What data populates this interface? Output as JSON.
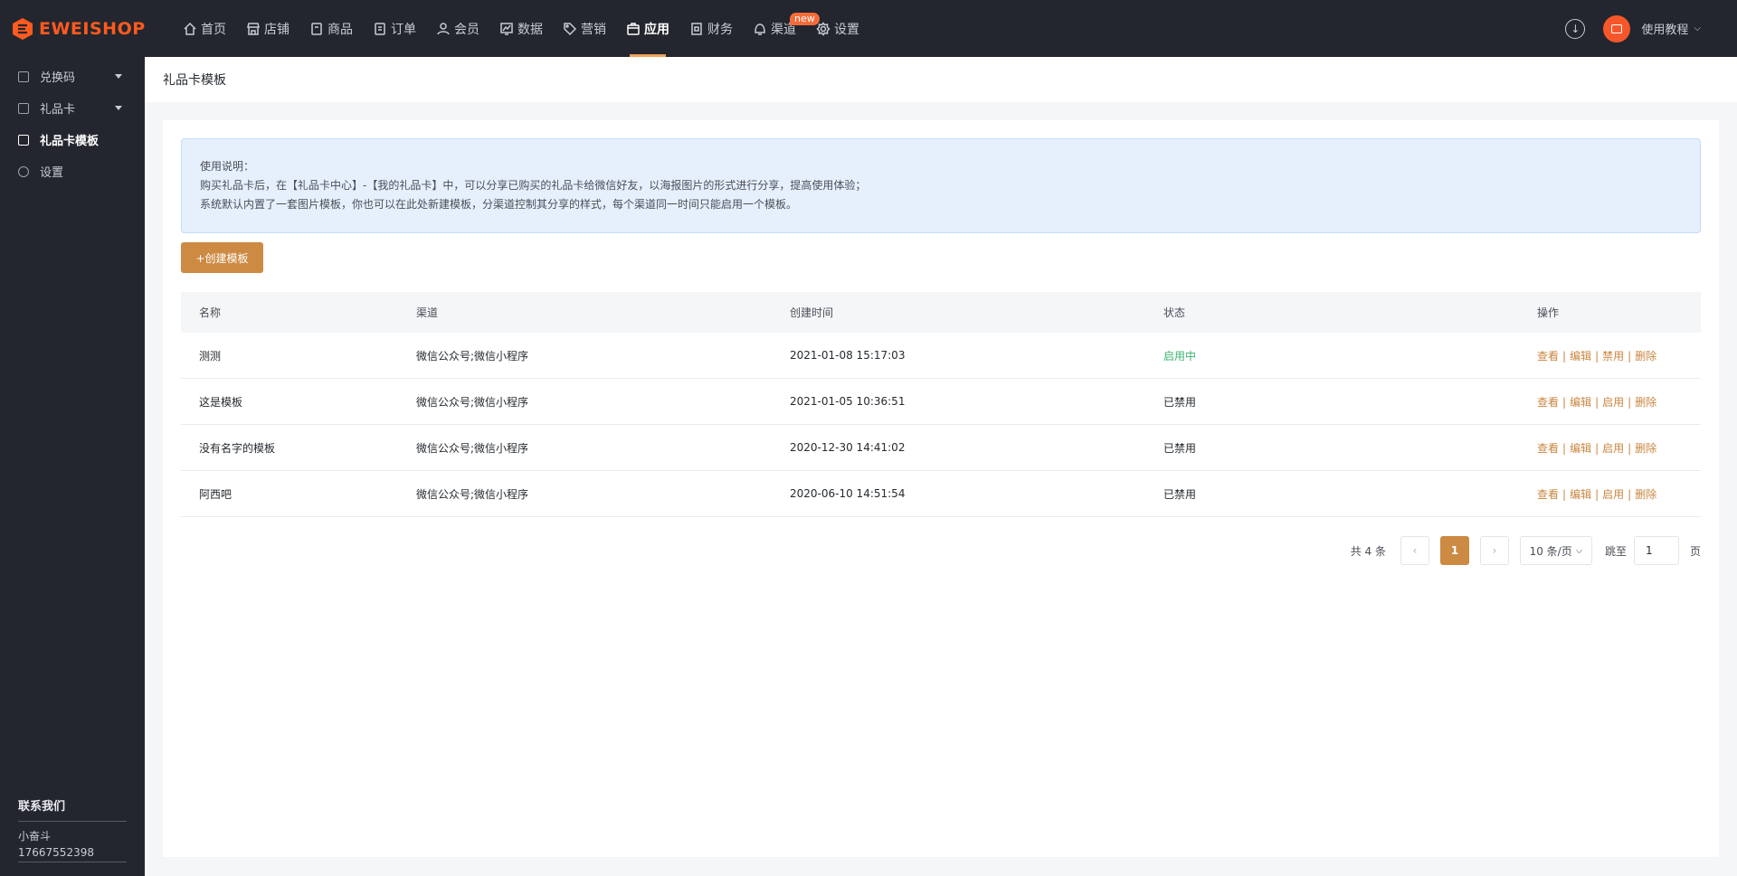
{
  "brand": {
    "name": "EWEISHOP",
    "color": "#ff5a1f"
  },
  "nav": {
    "items": [
      {
        "label": "首页",
        "icon": "home-icon"
      },
      {
        "label": "店铺",
        "icon": "store-icon"
      },
      {
        "label": "商品",
        "icon": "goods-icon"
      },
      {
        "label": "订单",
        "icon": "order-icon"
      },
      {
        "label": "会员",
        "icon": "member-icon"
      },
      {
        "label": "数据",
        "icon": "data-icon"
      },
      {
        "label": "营销",
        "icon": "tag-icon"
      },
      {
        "label": "应用",
        "icon": "app-icon",
        "active": true
      },
      {
        "label": "财务",
        "icon": "finance-icon"
      },
      {
        "label": "渠道",
        "icon": "channel-icon",
        "badge": "new"
      },
      {
        "label": "设置",
        "icon": "gear-icon"
      }
    ],
    "tutorial_label": "使用教程"
  },
  "sidebar": {
    "items": [
      {
        "label": "兑换码",
        "icon": "grid-icon",
        "expandable": true
      },
      {
        "label": "礼品卡",
        "icon": "card-icon",
        "expandable": true
      },
      {
        "label": "礼品卡模板",
        "icon": "template-icon",
        "active": true
      },
      {
        "label": "设置",
        "icon": "gear-icon"
      }
    ],
    "contact": {
      "title": "联系我们",
      "name": "小奋斗",
      "phone": "17667552398"
    }
  },
  "breadcrumb": "礼品卡模板",
  "notice": {
    "title": "使用说明：",
    "line1": "购买礼品卡后，在【礼品卡中心】-【我的礼品卡】中，可以分享已购买的礼品卡给微信好友，以海报图片的形式进行分享，提高使用体验；",
    "line2": "系统默认内置了一套图片模板，你也可以在此处新建模板，分渠道控制其分享的样式，每个渠道同一时间只能启用一个模板。"
  },
  "create_button": "+创建模板",
  "table": {
    "headers": [
      "名称",
      "渠道",
      "创建时间",
      "状态",
      "操作"
    ],
    "rows": [
      {
        "name": "测测",
        "channel": "微信公众号;微信小程序",
        "created": "2021-01-08 15:17:03",
        "status": "启用中",
        "enabled": true,
        "ops": [
          "查看",
          "编辑",
          "禁用",
          "删除"
        ]
      },
      {
        "name": "这是模板",
        "channel": "微信公众号;微信小程序",
        "created": "2021-01-05 10:36:51",
        "status": "已禁用",
        "enabled": false,
        "ops": [
          "查看",
          "编辑",
          "启用",
          "删除"
        ]
      },
      {
        "name": "没有名字的模板",
        "channel": "微信公众号;微信小程序",
        "created": "2020-12-30 14:41:02",
        "status": "已禁用",
        "enabled": false,
        "ops": [
          "查看",
          "编辑",
          "启用",
          "删除"
        ]
      },
      {
        "name": "阿西吧",
        "channel": "微信公众号;微信小程序",
        "created": "2020-06-10 14:51:54",
        "status": "已禁用",
        "enabled": false,
        "ops": [
          "查看",
          "编辑",
          "启用",
          "删除"
        ]
      }
    ]
  },
  "pager": {
    "total": "共 4 条",
    "current": "1",
    "page_size": "10 条/页",
    "jump_label": "跳至",
    "jump_value": "1",
    "page_unit": "页"
  },
  "colors": {
    "accent": "#cd8a43",
    "status_on": "#3cb371",
    "nav_bg": "#23262e"
  }
}
